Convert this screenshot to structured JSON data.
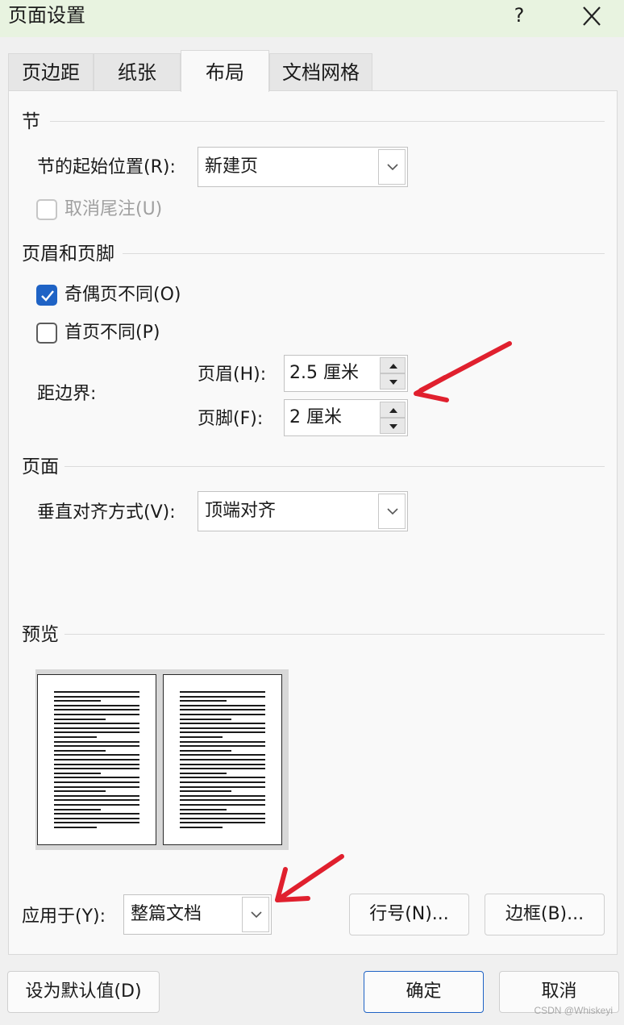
{
  "window": {
    "title": "页面设置",
    "help": "?"
  },
  "tabs": [
    {
      "label": "页边距",
      "active": false
    },
    {
      "label": "纸张",
      "active": false
    },
    {
      "label": "布局",
      "active": true
    },
    {
      "label": "文档网格",
      "active": false
    }
  ],
  "section": {
    "title": "节",
    "start_label": "节的起始位置(R):",
    "start_value": "新建页",
    "suppress_endnotes": {
      "label": "取消尾注(U)",
      "checked": false,
      "enabled": false
    }
  },
  "headers_footers": {
    "title": "页眉和页脚",
    "odd_even": {
      "label": "奇偶页不同(O)",
      "checked": true
    },
    "first_page": {
      "label": "首页不同(P)",
      "checked": false
    },
    "from_edge_label": "距边界:",
    "header_label": "页眉(H):",
    "header_value": "2.5 厘米",
    "footer_label": "页脚(F):",
    "footer_value": "2 厘米"
  },
  "page": {
    "title": "页面",
    "valign_label": "垂直对齐方式(V):",
    "valign_value": "顶端对齐"
  },
  "preview": {
    "title": "预览"
  },
  "apply": {
    "label": "应用于(Y):",
    "value": "整篇文档",
    "line_numbers": "行号(N)...",
    "borders": "边框(B)..."
  },
  "footer": {
    "set_default": "设为默认值(D)",
    "ok": "确定",
    "cancel": "取消"
  },
  "watermark": "CSDN @Whiskeyi",
  "colors": {
    "accent": "#1f63c5",
    "annotation_arrow": "#e0202e",
    "titlebar": "#e8f3e0"
  }
}
